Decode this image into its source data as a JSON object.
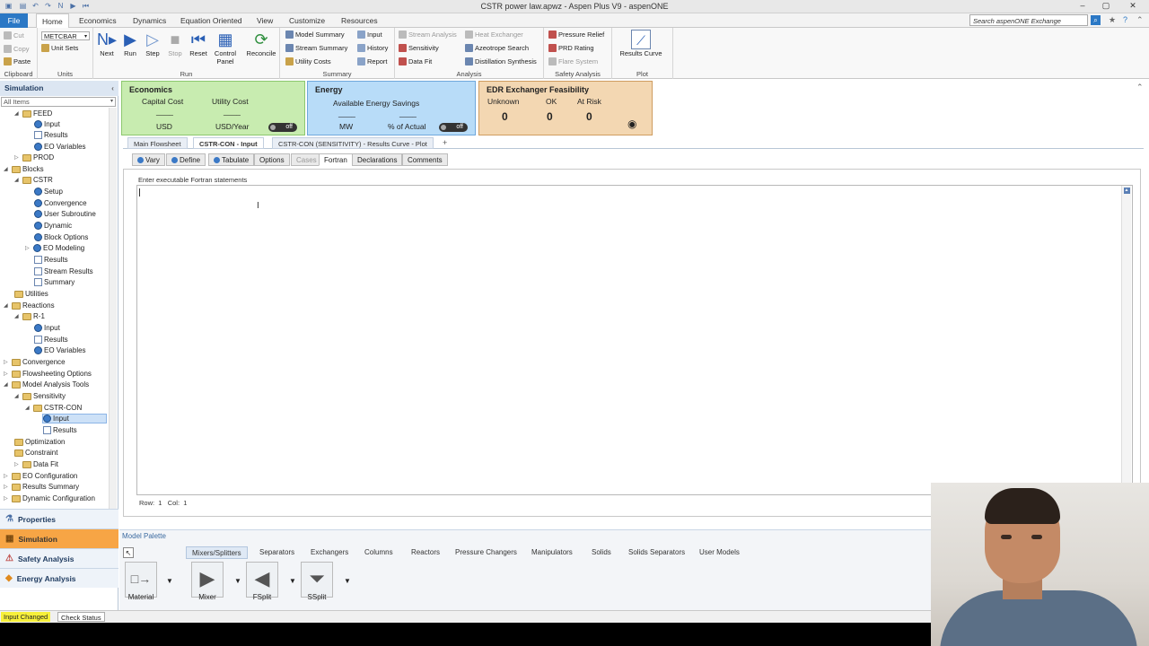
{
  "window": {
    "title": "CSTR power law.apwz - Aspen Plus V9 - aspenONE"
  },
  "menu": {
    "tabs": [
      "File",
      "Home",
      "Economics",
      "Dynamics",
      "Equation Oriented",
      "View",
      "Customize",
      "Resources"
    ],
    "active": "Home",
    "search_placeholder": "Search aspenONE Exchange"
  },
  "ribbon": {
    "clipboard": {
      "cut": "Cut",
      "copy": "Copy",
      "paste": "Paste",
      "label": "Clipboard"
    },
    "units": {
      "set": "METCBAR",
      "unit_sets": "Unit Sets",
      "label": "Units"
    },
    "run": {
      "next": "Next",
      "run": "Run",
      "step": "Step",
      "stop": "Stop",
      "reset": "Reset",
      "control_panel_1": "Control",
      "control_panel_2": "Panel",
      "reconcile": "Reconcile",
      "label": "Run"
    },
    "summary": {
      "model_summary": "Model Summary",
      "stream_summary": "Stream Summary",
      "utility_costs": "Utility Costs",
      "input": "Input",
      "history": "History",
      "report": "Report",
      "label": "Summary"
    },
    "analysis": {
      "stream_analysis": "Stream Analysis",
      "sensitivity": "Sensitivity",
      "data_fit": "Data Fit",
      "heat_exchanger": "Heat Exchanger",
      "azeotrope": "Azeotrope Search",
      "distillation": "Distillation Synthesis",
      "label": "Analysis"
    },
    "safety": {
      "pressure_relief": "Pressure Relief",
      "prd_rating": "PRD Rating",
      "flare_system": "Flare System",
      "label": "Safety Analysis"
    },
    "plot": {
      "results_curve": "Results Curve",
      "label": "Plot"
    }
  },
  "nav": {
    "header": "Simulation",
    "filter": "All Items",
    "items": [
      {
        "label": "FEED"
      },
      {
        "label": "Input"
      },
      {
        "label": "Results"
      },
      {
        "label": "EO Variables"
      },
      {
        "label": "PROD"
      },
      {
        "label": "Blocks"
      },
      {
        "label": "CSTR"
      },
      {
        "label": "Setup"
      },
      {
        "label": "Convergence"
      },
      {
        "label": "User Subroutine"
      },
      {
        "label": "Dynamic"
      },
      {
        "label": "Block Options"
      },
      {
        "label": "EO Modeling"
      },
      {
        "label": "Results"
      },
      {
        "label": "Stream Results"
      },
      {
        "label": "Summary"
      },
      {
        "label": "Utilities"
      },
      {
        "label": "Reactions"
      },
      {
        "label": "R-1"
      },
      {
        "label": "Input"
      },
      {
        "label": "Results"
      },
      {
        "label": "EO Variables"
      },
      {
        "label": "Convergence"
      },
      {
        "label": "Flowsheeting Options"
      },
      {
        "label": "Model Analysis Tools"
      },
      {
        "label": "Sensitivity"
      },
      {
        "label": "CSTR-CON"
      },
      {
        "label": "Input"
      },
      {
        "label": "Results"
      },
      {
        "label": "Optimization"
      },
      {
        "label": "Constraint"
      },
      {
        "label": "Data Fit"
      },
      {
        "label": "EO Configuration"
      },
      {
        "label": "Results Summary"
      },
      {
        "label": "Dynamic Configuration"
      }
    ],
    "bottom": [
      "Properties",
      "Simulation",
      "Safety Analysis",
      "Energy Analysis"
    ]
  },
  "dashboard": {
    "economics": {
      "title": "Economics",
      "capital_cost": "Capital Cost",
      "utility_cost": "Utility Cost",
      "dash": "____",
      "usd": "USD",
      "usd_year": "USD/Year",
      "toggle": "off"
    },
    "energy": {
      "title": "Energy",
      "savings": "Available Energy Savings",
      "dash": "____",
      "mw": "MW",
      "pct": "% of Actual",
      "toggle": "off"
    },
    "edr": {
      "title": "EDR Exchanger Feasibility",
      "unknown": "Unknown",
      "ok": "OK",
      "at_risk": "At Risk",
      "v_unknown": "0",
      "v_ok": "0",
      "v_risk": "0"
    }
  },
  "doc_tabs": [
    "Main Flowsheet",
    "CSTR-CON - Input",
    "CSTR-CON (SENSITIVITY) - Results Curve - Plot",
    "+"
  ],
  "form_tabs": [
    "Vary",
    "Define",
    "Tabulate",
    "Options",
    "Cases",
    "Fortran",
    "Declarations",
    "Comments"
  ],
  "editor": {
    "label": "Enter executable Fortran statements",
    "row_label": "Row:",
    "row": "1",
    "col_label": "Col:",
    "col": "1"
  },
  "palette": {
    "title": "Model Palette",
    "tabs": [
      "Mixers/Splitters",
      "Separators",
      "Exchangers",
      "Columns",
      "Reactors",
      "Pressure Changers",
      "Manipulators",
      "Solids",
      "Solids Separators",
      "User Models"
    ],
    "models": [
      "Material",
      "Mixer",
      "FSplit",
      "SSplit"
    ]
  },
  "status": {
    "input_changed": "Input Changed",
    "check_status": "Check Status"
  },
  "colors": {
    "file_tab": "#2b78c5",
    "economics": "#c8ecb0",
    "energy": "#b8dcf8",
    "edr": "#f3d7b2",
    "status_highlight": "#f7f03a",
    "nav_active": "#f7a545"
  }
}
